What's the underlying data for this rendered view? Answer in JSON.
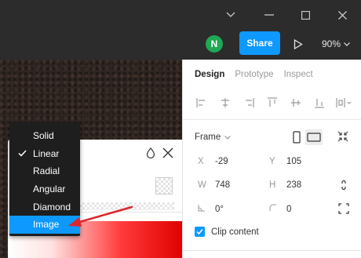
{
  "toolbar": {
    "avatar_initial": "N",
    "share_label": "Share",
    "zoom_level": "90%"
  },
  "panel": {
    "tabs": [
      {
        "label": "Design",
        "active": true
      },
      {
        "label": "Prototype",
        "active": false
      },
      {
        "label": "Inspect",
        "active": false
      }
    ],
    "frame_label": "Frame",
    "x_label": "X",
    "x_value": "-29",
    "y_label": "Y",
    "y_value": "105",
    "w_label": "W",
    "w_value": "748",
    "h_label": "H",
    "h_value": "238",
    "rotation_value": "0°",
    "radius_value": "0",
    "clip_content_label": "Clip content",
    "clip_content_checked": true
  },
  "fill_menu": {
    "items": [
      {
        "label": "Solid",
        "checked": false,
        "selected": false
      },
      {
        "label": "Linear",
        "checked": true,
        "selected": false
      },
      {
        "label": "Radial",
        "checked": false,
        "selected": false
      },
      {
        "label": "Angular",
        "checked": false,
        "selected": false
      },
      {
        "label": "Diamond",
        "checked": false,
        "selected": false
      },
      {
        "label": "Image",
        "checked": false,
        "selected": true
      }
    ]
  },
  "colors": {
    "accent": "#0d99ff",
    "avatar": "#1fa855",
    "arrow": "#e0242a"
  },
  "icons": {
    "window": [
      "chevron-down-icon",
      "minimize-icon",
      "maximize-icon",
      "close-icon"
    ],
    "play": "play-icon",
    "popup": [
      "water-drop-icon",
      "close-icon"
    ]
  }
}
